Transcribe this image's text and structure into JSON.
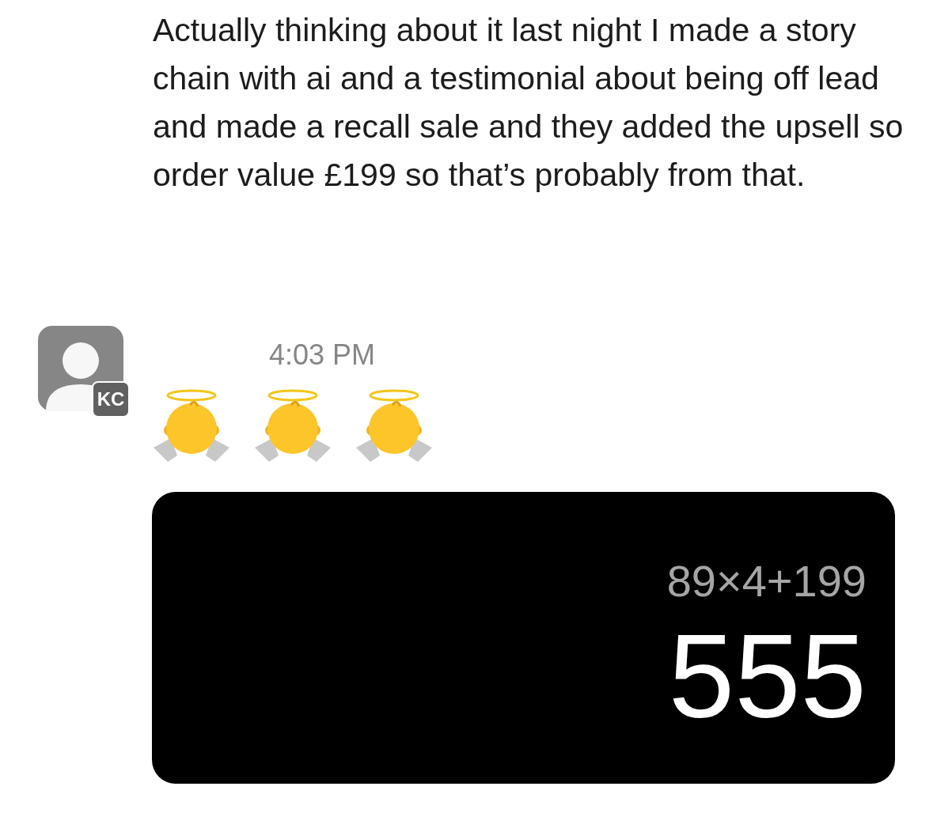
{
  "previous_message": {
    "text": "Actually thinking about it last night I made a story chain with ai and a testimonial about being off lead and made a recall sale and they added the upsell so order value £199 so that’s probably from that."
  },
  "message": {
    "avatar": {
      "initials": "KC"
    },
    "timestamp": "4:03 PM",
    "emoji": [
      {
        "kind": "angel"
      },
      {
        "kind": "angel"
      },
      {
        "kind": "angel"
      }
    ],
    "attachment": {
      "expression": "89×4+199",
      "result": "555"
    }
  }
}
